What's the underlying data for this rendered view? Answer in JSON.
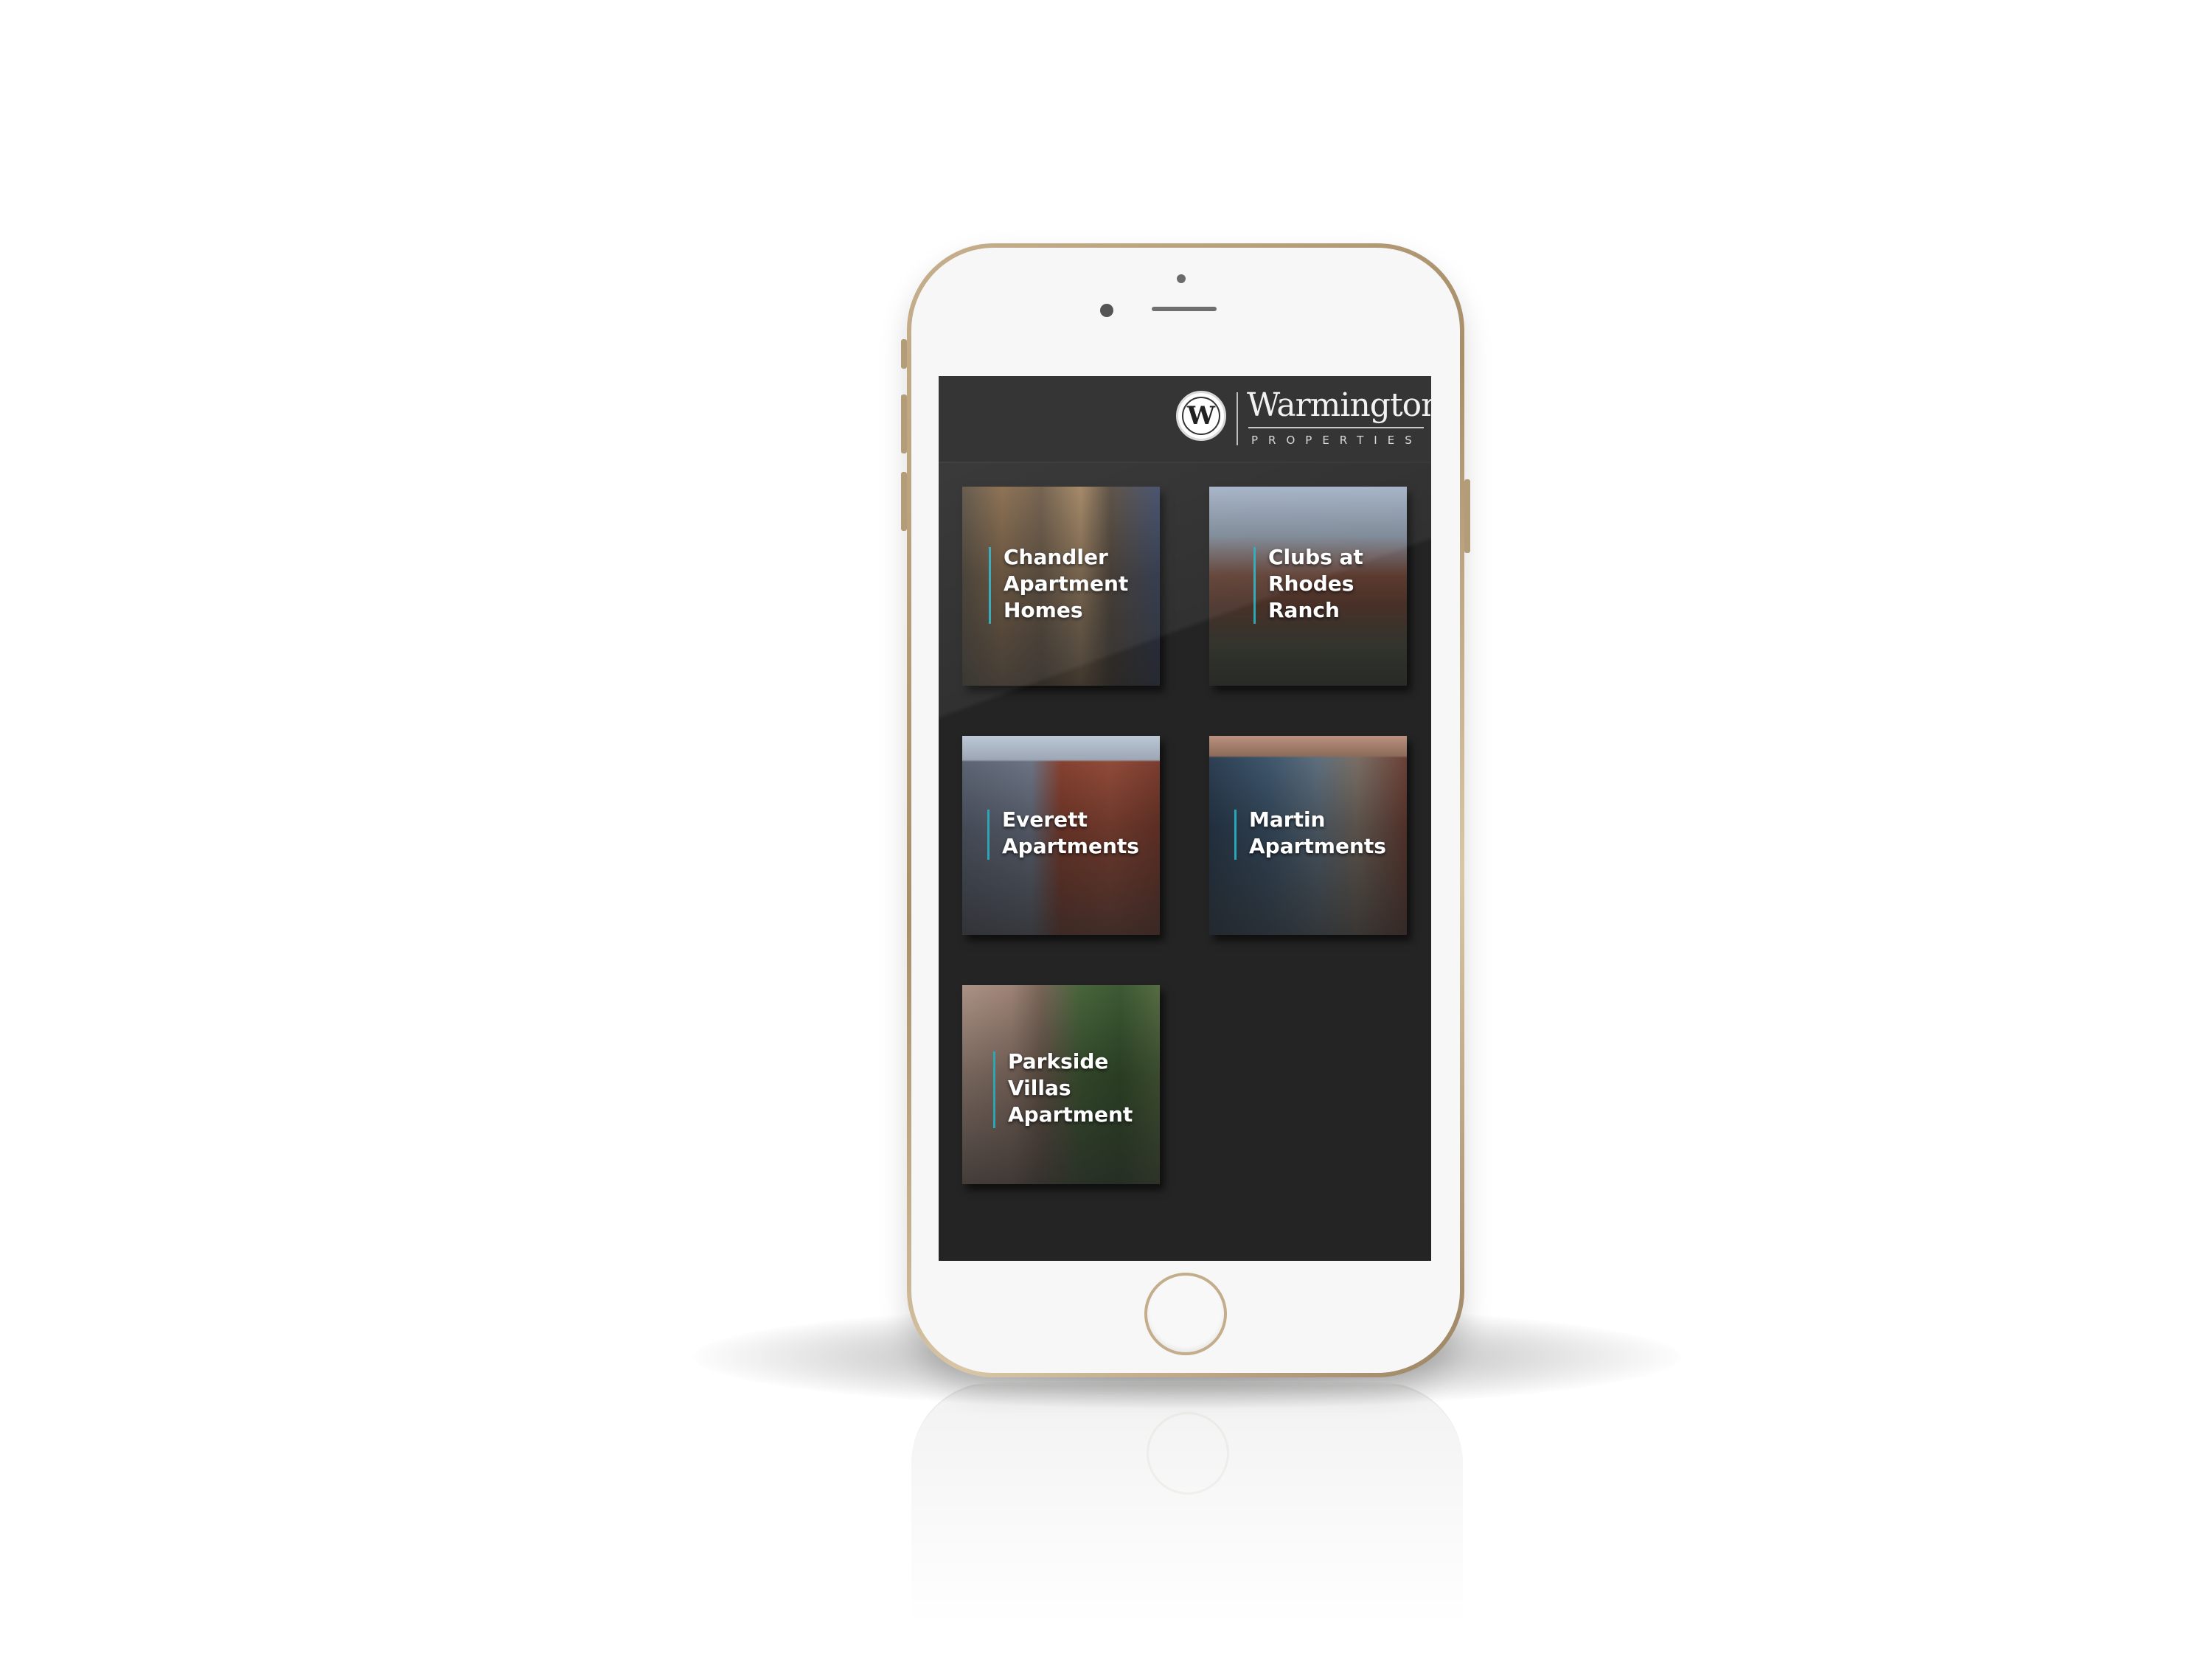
{
  "brand": {
    "logo_letter": "W",
    "name": "Warmington",
    "tagline": "PROPERTIES",
    "accent_color": "#2aa6b7",
    "screen_bg": "#242424",
    "header_bg": "#353535"
  },
  "properties": [
    {
      "lines": [
        "Chandler",
        "Apartment",
        "Homes"
      ]
    },
    {
      "lines": [
        "Clubs at",
        "Rhodes",
        "Ranch"
      ]
    },
    {
      "lines": [
        "Everett",
        "Apartments"
      ]
    },
    {
      "lines": [
        "Martin",
        "Apartments"
      ]
    },
    {
      "lines": [
        "Parkside",
        "Villas",
        "Apartment"
      ]
    }
  ]
}
